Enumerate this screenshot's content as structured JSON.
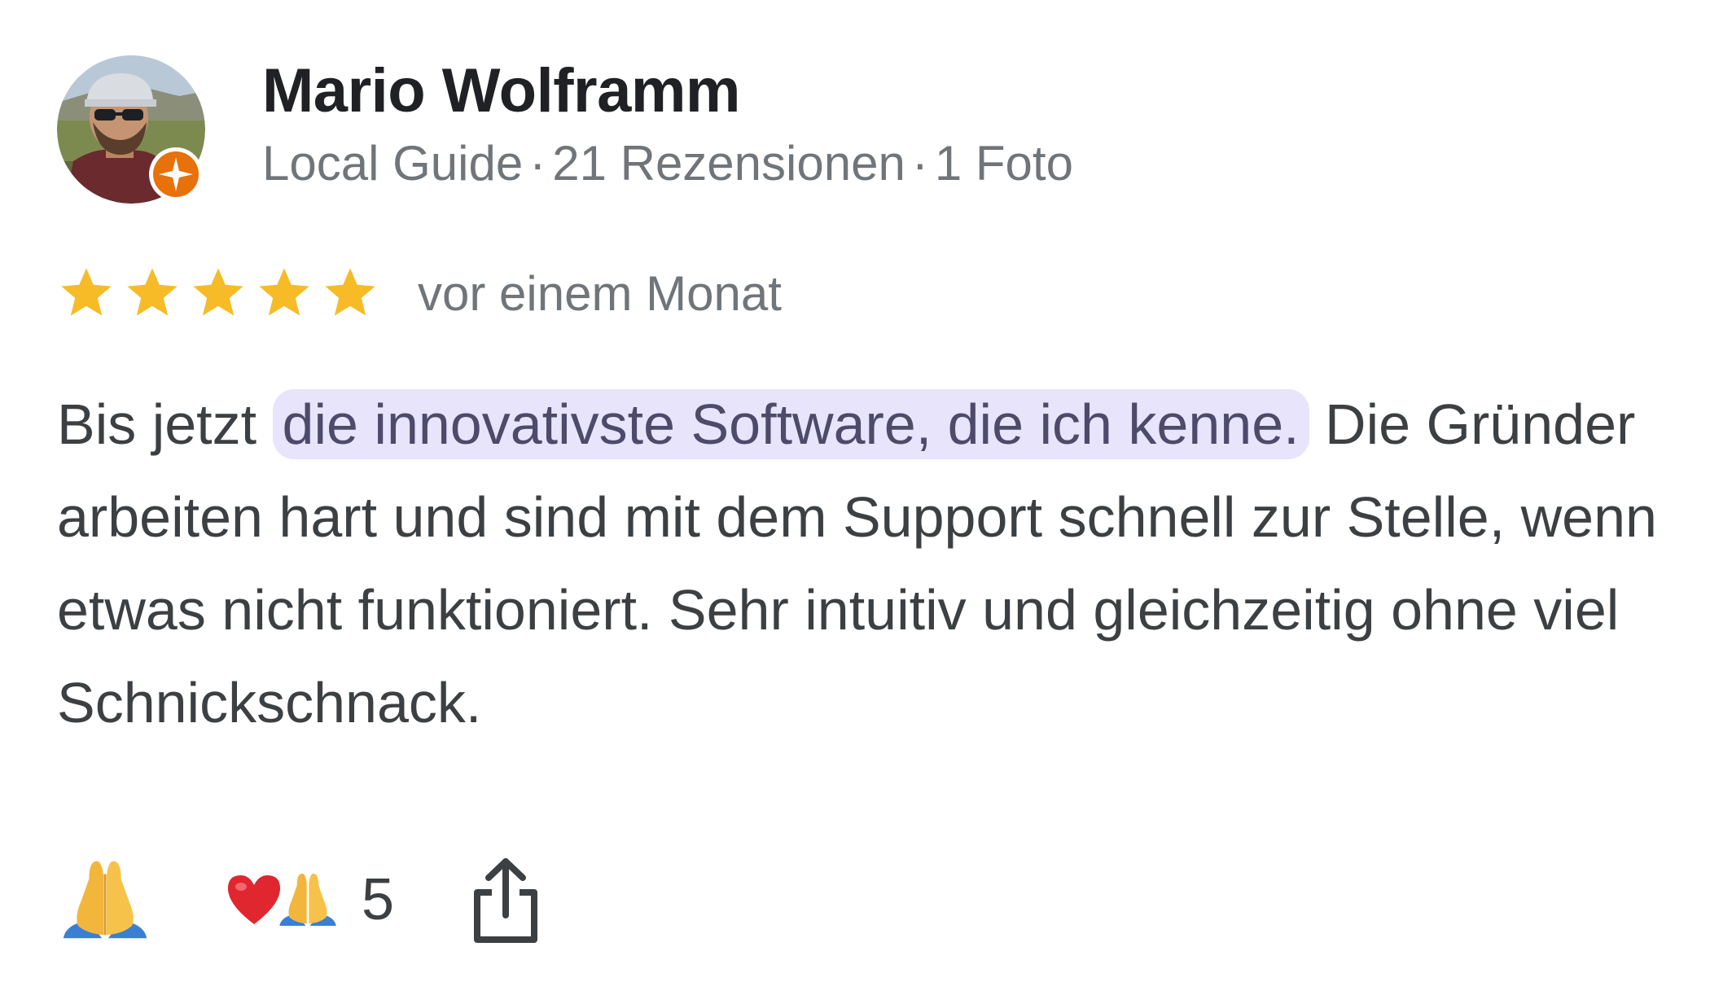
{
  "reviewer": {
    "name": "Mario Wolframm",
    "meta": {
      "level": "Local Guide",
      "separator": "·",
      "reviews": "21 Rezensionen",
      "photos": "1 Foto"
    },
    "badge_icon": "local-guide-star-icon",
    "badge_color": "#e8710a"
  },
  "rating": {
    "stars": 5,
    "max": 5,
    "star_color": "#f6bb26",
    "date": "vor einem Monat"
  },
  "review": {
    "before": "Bis jetzt",
    "highlight": "die innovativste Software, die ich kenne.",
    "after": "Die Gründer arbeiten hart und sind mit dem Support schnell zur Stelle, wenn etwas nicht funktioniert. Sehr intuitiv und gleichzeitig ohne viel Schnickschnack.",
    "highlight_color": "#e8e4fc"
  },
  "reactions": {
    "react_icon": "folded-hands-icon",
    "summary_icons": [
      "red-heart-icon",
      "folded-hands-icon"
    ],
    "count": "5",
    "share_icon": "share-icon"
  }
}
